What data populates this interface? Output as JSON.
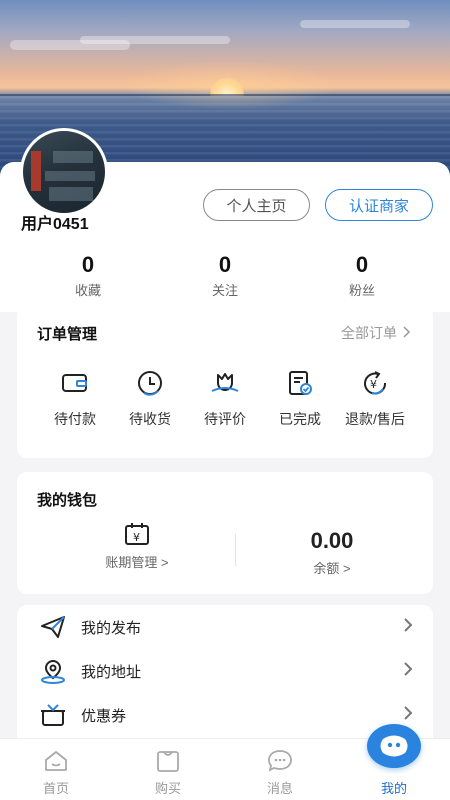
{
  "profile": {
    "username": "用户0451",
    "home_button": "个人主页",
    "merchant_button": "认证商家"
  },
  "stats": [
    {
      "value": "0",
      "label": "收藏"
    },
    {
      "value": "0",
      "label": "关注"
    },
    {
      "value": "0",
      "label": "粉丝"
    }
  ],
  "orders": {
    "title": "订单管理",
    "all_link": "全部订单",
    "items": [
      {
        "label": "待付款",
        "icon": "wallet-icon"
      },
      {
        "label": "待收货",
        "icon": "clock-icon"
      },
      {
        "label": "待评价",
        "icon": "flower-icon"
      },
      {
        "label": "已完成",
        "icon": "document-check-icon"
      },
      {
        "label": "退款/售后",
        "icon": "refund-icon"
      }
    ]
  },
  "wallet": {
    "title": "我的钱包",
    "billing_label": "账期管理 >",
    "balance_value": "0.00",
    "balance_label": "余额 >"
  },
  "menu": [
    {
      "label": "我的发布",
      "icon": "send-icon"
    },
    {
      "label": "我的地址",
      "icon": "location-icon"
    },
    {
      "label": "优惠券",
      "icon": "gift-icon"
    }
  ],
  "tabs": [
    {
      "label": "首页",
      "icon": "home-icon"
    },
    {
      "label": "购买",
      "icon": "bag-icon"
    },
    {
      "label": "消息",
      "icon": "chat-icon"
    },
    {
      "label": "我的",
      "icon": "profile-face-icon"
    }
  ],
  "colors": {
    "accent": "#2f86d8",
    "active_tab": "#1f6fd0",
    "fab": "#2a83df"
  }
}
